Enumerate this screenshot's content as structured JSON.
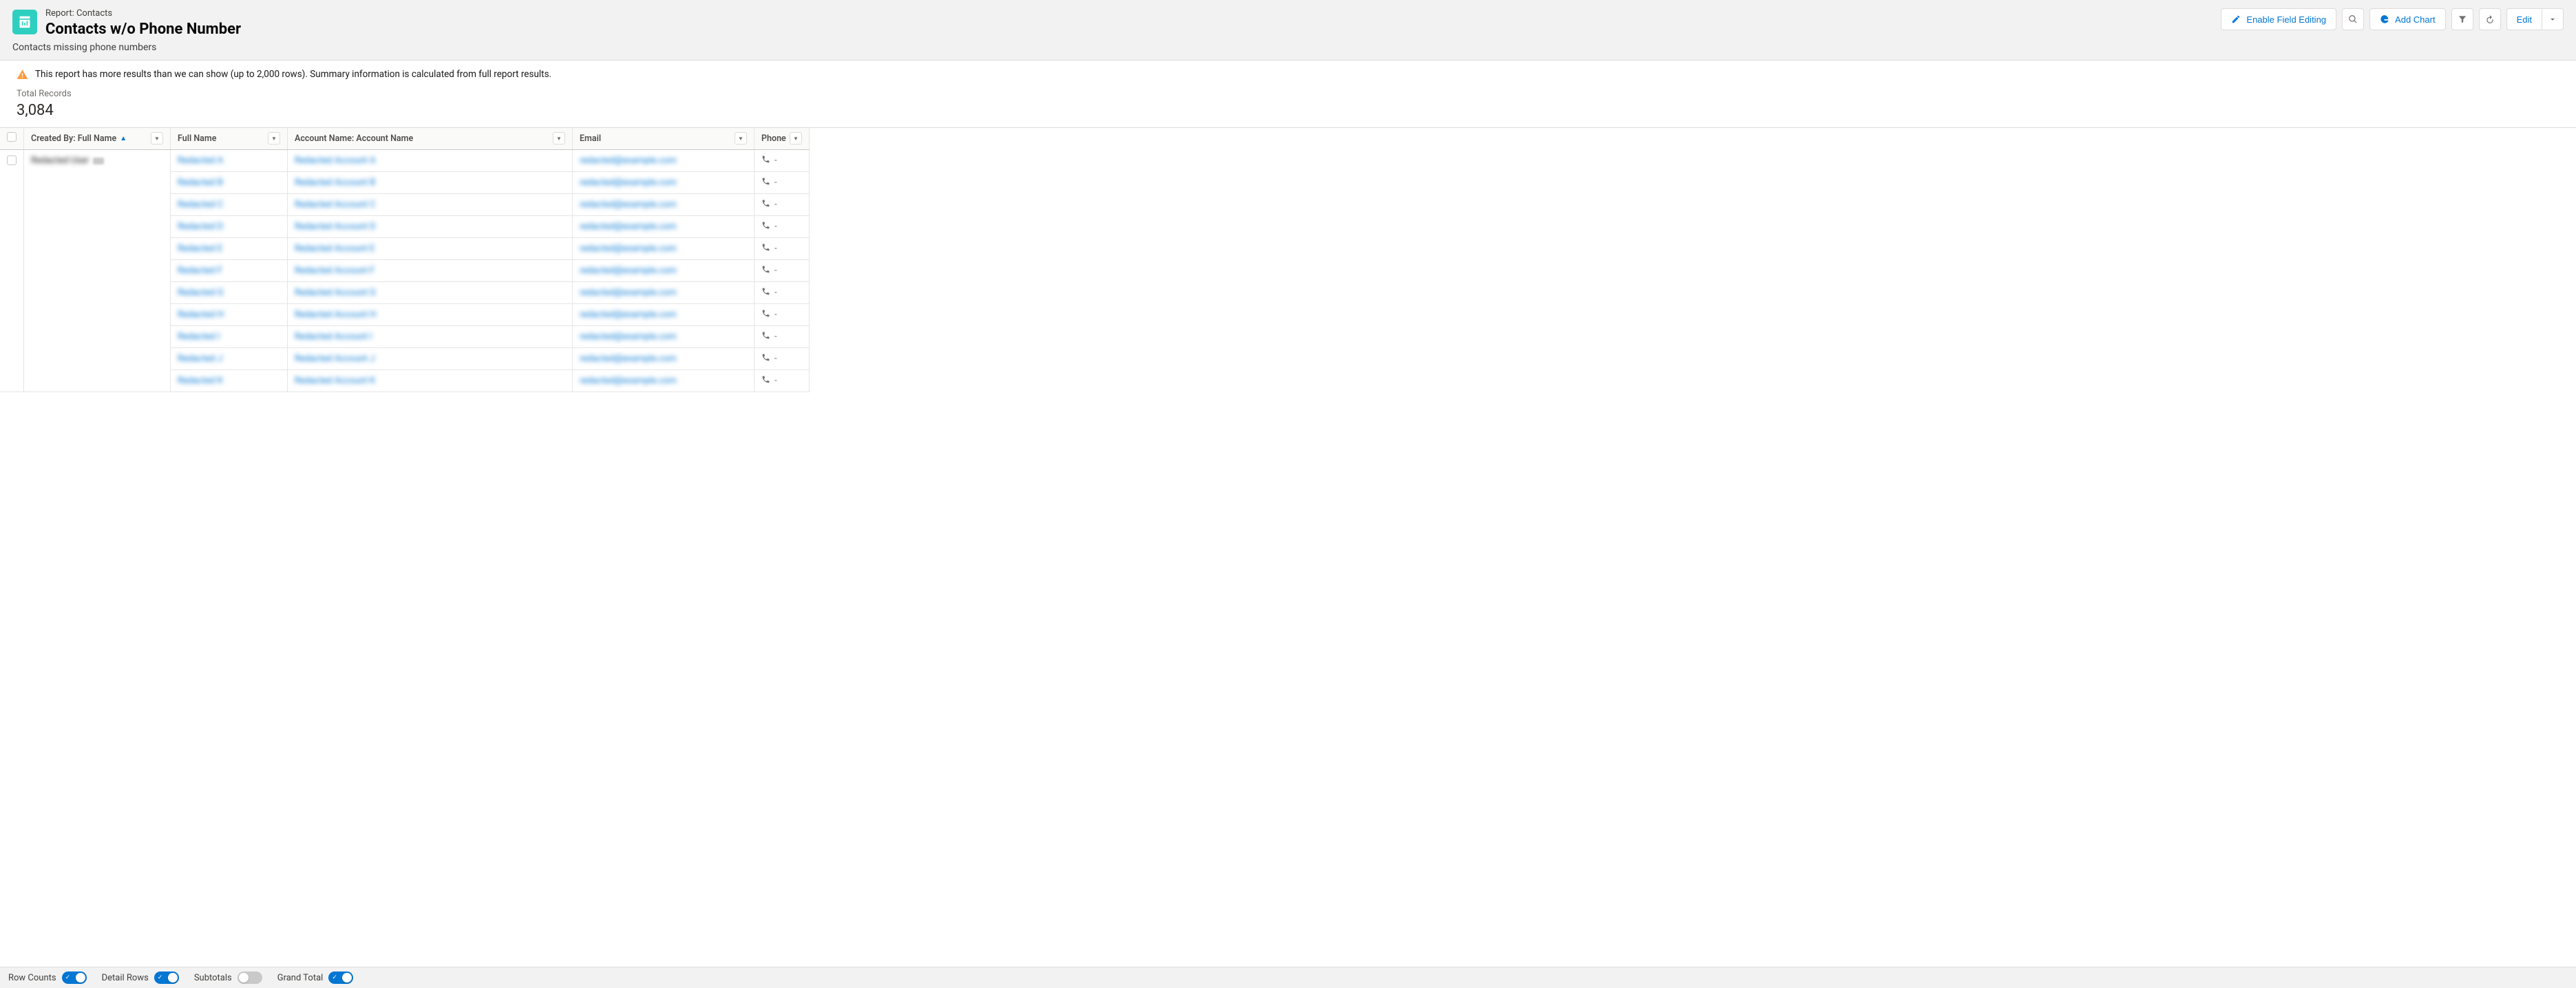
{
  "header": {
    "report_type_label": "Report: Contacts",
    "report_title": "Contacts w/o Phone Number",
    "report_subtitle": "Contacts missing phone numbers",
    "enable_editing_label": "Enable Field Editing",
    "add_chart_label": "Add Chart",
    "edit_label": "Edit"
  },
  "warning": {
    "text": "This report has more results than we can show (up to 2,000 rows). Summary information is calculated from full report results."
  },
  "summary": {
    "total_records_label": "Total Records",
    "total_records_value": "3,084"
  },
  "columns": {
    "created_by": "Created By: Full Name",
    "full_name": "Full Name",
    "account_name": "Account Name: Account Name",
    "email": "Email",
    "phone": "Phone"
  },
  "group": {
    "created_by": "Redacted User"
  },
  "rows": [
    {
      "full_name": "Redacted A",
      "account_name": "Redacted Account A",
      "email": "redacted@example.com",
      "phone": "-"
    },
    {
      "full_name": "Redacted B",
      "account_name": "Redacted Account B",
      "email": "redacted@example.com",
      "phone": "-"
    },
    {
      "full_name": "Redacted C",
      "account_name": "Redacted Account C",
      "email": "redacted@example.com",
      "phone": "-"
    },
    {
      "full_name": "Redacted D",
      "account_name": "Redacted Account D",
      "email": "redacted@example.com",
      "phone": "-"
    },
    {
      "full_name": "Redacted E",
      "account_name": "Redacted Account E",
      "email": "redacted@example.com",
      "phone": "-"
    },
    {
      "full_name": "Redacted F",
      "account_name": "Redacted Account F",
      "email": "redacted@example.com",
      "phone": "-"
    },
    {
      "full_name": "Redacted G",
      "account_name": "Redacted Account G",
      "email": "redacted@example.com",
      "phone": "-"
    },
    {
      "full_name": "Redacted H",
      "account_name": "Redacted Account H",
      "email": "redacted@example.com",
      "phone": "-"
    },
    {
      "full_name": "Redacted I",
      "account_name": "Redacted Account I",
      "email": "redacted@example.com",
      "phone": "-"
    },
    {
      "full_name": "Redacted J",
      "account_name": "Redacted Account J",
      "email": "redacted@example.com",
      "phone": "-"
    },
    {
      "full_name": "Redacted K",
      "account_name": "Redacted Account K",
      "email": "redacted@example.com",
      "phone": "-"
    }
  ],
  "footer": {
    "row_counts_label": "Row Counts",
    "row_counts_on": true,
    "detail_rows_label": "Detail Rows",
    "detail_rows_on": true,
    "subtotals_label": "Subtotals",
    "subtotals_on": false,
    "grand_total_label": "Grand Total",
    "grand_total_on": true
  }
}
